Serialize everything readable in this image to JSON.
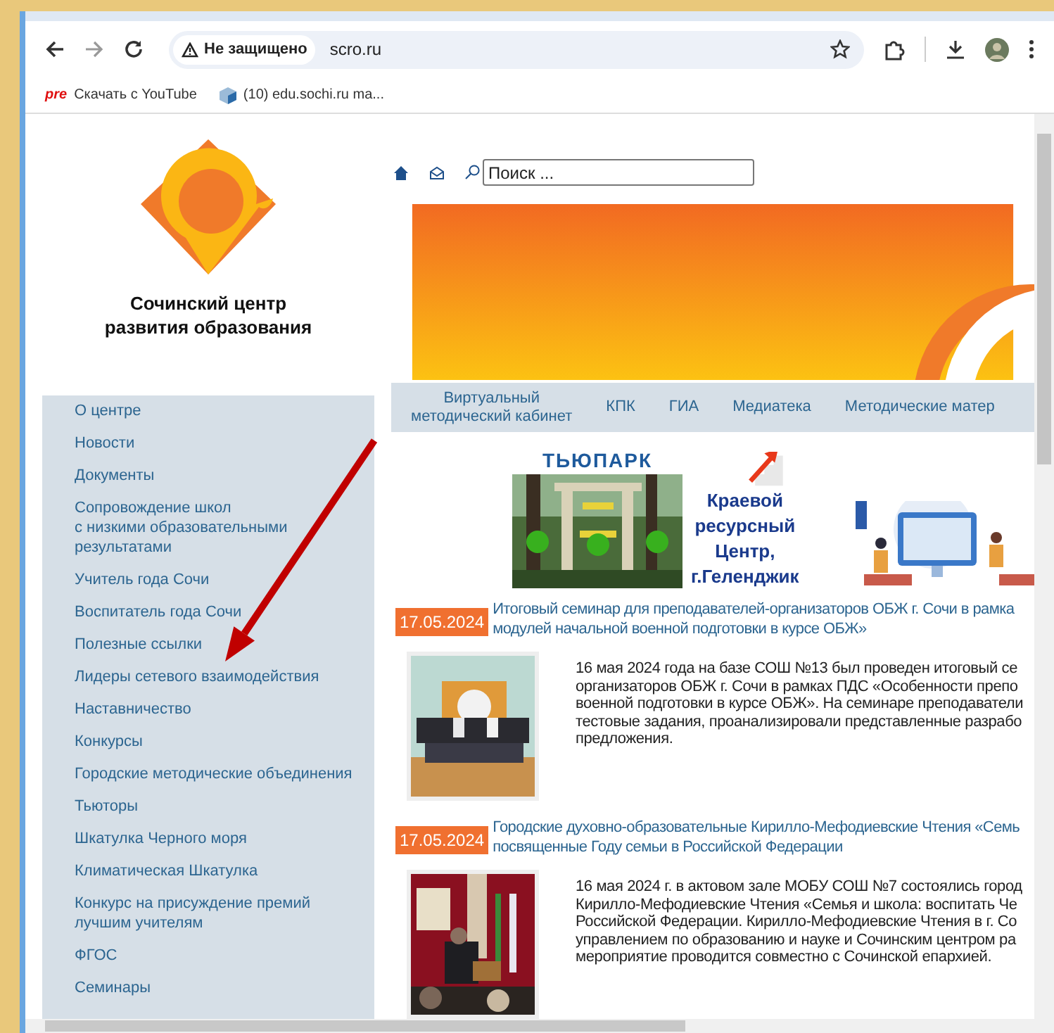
{
  "browser": {
    "security_label": "Не защищено",
    "url": "scro.ru",
    "bookmarks": [
      {
        "icon_text": "pre",
        "label": "Скачать с YouTube"
      },
      {
        "label": "(10) edu.sochi.ru ma..."
      }
    ]
  },
  "logo": {
    "lines": [
      "Сочинский центр",
      "развития образования"
    ]
  },
  "search": {
    "placeholder": "Поиск ..."
  },
  "top_menu": [
    {
      "lines": [
        "Виртуальный",
        "методический кабинет"
      ]
    },
    {
      "lines": [
        "КПК"
      ]
    },
    {
      "lines": [
        "ГИА"
      ]
    },
    {
      "lines": [
        "Медиатека"
      ]
    },
    {
      "lines": [
        "Методические матер"
      ]
    }
  ],
  "sidebar": {
    "items": [
      {
        "lines": [
          "О центре"
        ]
      },
      {
        "lines": [
          "Новости"
        ]
      },
      {
        "lines": [
          "Документы"
        ]
      },
      {
        "lines": [
          "Сопровождение школ",
          "с низкими образовательными",
          "результатами"
        ]
      },
      {
        "lines": [
          "Учитель года Сочи"
        ]
      },
      {
        "lines": [
          "Воспитатель года Сочи"
        ]
      },
      {
        "lines": [
          "Полезные ссылки"
        ]
      },
      {
        "lines": [
          "Лидеры сетевого взаимодействия"
        ]
      },
      {
        "lines": [
          "Наставничество"
        ]
      },
      {
        "lines": [
          "Конкурсы"
        ]
      },
      {
        "lines": [
          "Городские методические объединения"
        ]
      },
      {
        "lines": [
          "Тьюторы"
        ]
      },
      {
        "lines": [
          "Шкатулка Черного моря"
        ]
      },
      {
        "lines": [
          "Климатическая Шкатулка"
        ]
      },
      {
        "lines": [
          "Конкурс на присуждение премий",
          "лучшим учителям"
        ]
      },
      {
        "lines": [
          "ФГОС"
        ]
      },
      {
        "lines": [
          "Семинары"
        ]
      }
    ]
  },
  "banners": [
    {
      "kind": "photo_banner",
      "caption": "ТЬЮПАРК"
    },
    {
      "kind": "text_banner",
      "lines": [
        "Краевой",
        "ресурсный",
        "Центр,",
        "г.Геленджик"
      ]
    },
    {
      "kind": "illustration"
    }
  ],
  "news": [
    {
      "date": "17.05.2024",
      "title_lines": [
        "Итоговый семинар для преподавателей-организаторов ОБЖ г. Сочи в рамка",
        "модулей начальной военной подготовки в курсе ОБЖ»"
      ],
      "body_lines": [
        "16 мая 2024 года на базе СОШ №13 был проведен итоговый се",
        "организаторов ОБЖ г. Сочи в рамках ПДС «Особенности препо",
        "военной подготовки в курсе ОБЖ». На семинаре преподаватели",
        "тестовые задания, проанализировали представленные разрабо",
        "предложения."
      ]
    },
    {
      "date": "17.05.2024",
      "title_lines": [
        "Городские духовно-образовательные Кирилло-Мефодиевские Чтения «Семь",
        "посвященные Году семьи в Российской Федерации"
      ],
      "body_lines": [
        "16 мая 2024 г. в актовом зале МОБУ СОШ №7 состоялись город",
        "Кирилло-Мефодиевские Чтения «Семья и школа: воспитать Че",
        "Российской Федерации. Кирилло-Мефодиевские Чтения в г. Со",
        "управлением по образованию и науке и Сочинским центром ра",
        "мероприятие проводится совместно с Сочинской епархией."
      ]
    }
  ]
}
